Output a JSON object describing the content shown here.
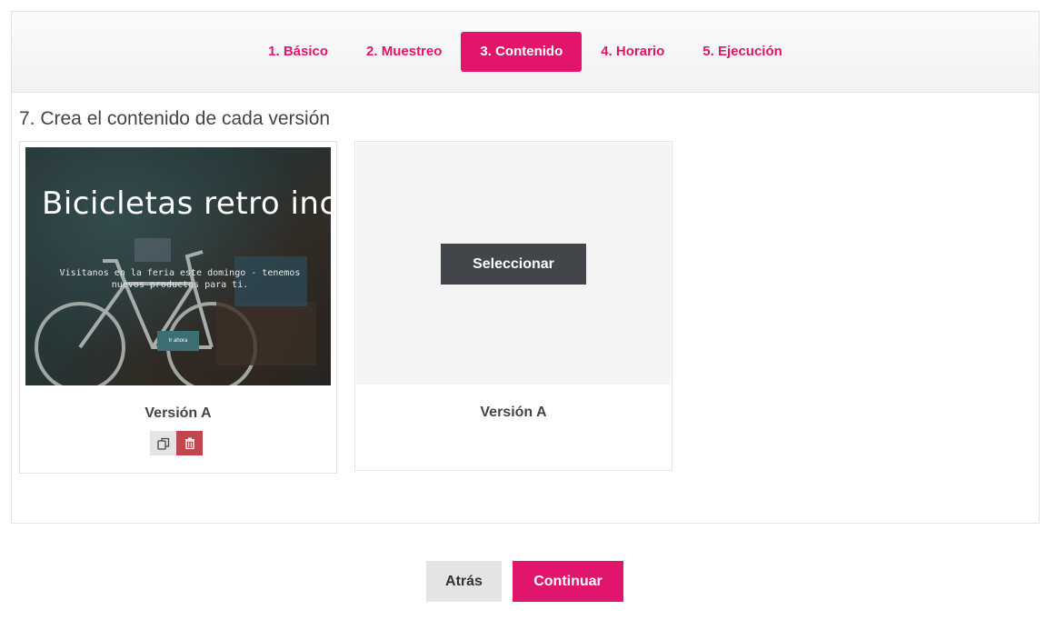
{
  "steps": [
    {
      "label": "1. Básico"
    },
    {
      "label": "2. Muestreo"
    },
    {
      "label": "3. Contenido"
    },
    {
      "label": "4. Horario"
    },
    {
      "label": "5. Ejecución"
    }
  ],
  "active_step": 2,
  "section_title": "7. Crea el contenido de cada versión",
  "versions": [
    {
      "label": "Versión A",
      "preview": {
        "title": "Bicicletas retro inc.",
        "subtitle": "Visitanos en la feria este domingo - tenemos nuevos productos para ti.",
        "cta": "Ir ahora"
      },
      "actions": {
        "copy_icon": "copy-icon",
        "delete_icon": "trash-icon"
      }
    },
    {
      "label": "Versión A",
      "select_label": "Seleccionar"
    }
  ],
  "footer": {
    "back_label": "Atrás",
    "continue_label": "Continuar"
  },
  "colors": {
    "accent": "#e0156b",
    "dark_button": "#42464b",
    "delete": "#c0474c"
  }
}
